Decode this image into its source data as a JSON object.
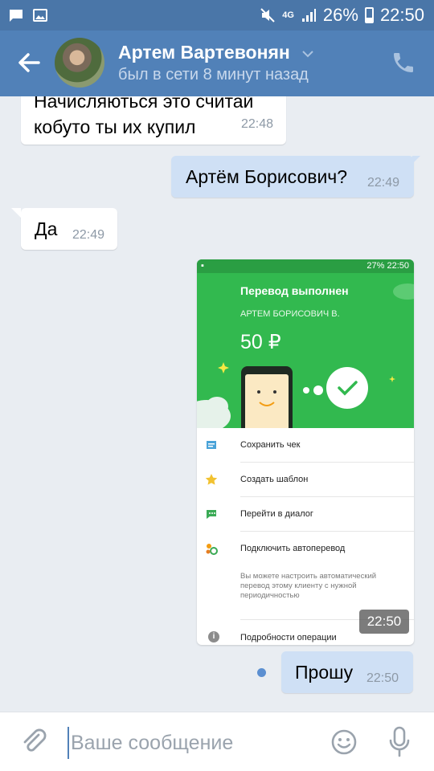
{
  "status_bar": {
    "signal": "4G",
    "battery": "26%",
    "time": "22:50"
  },
  "header": {
    "name": "Артем Вартевонян",
    "status": "был в сети 8 минут назад"
  },
  "messages": [
    {
      "direction": "in",
      "text_line1": "Начисляються это считай",
      "text_line2": "кобуто ты их купил",
      "time": "22:48"
    },
    {
      "direction": "out",
      "text": "Артём Борисович?",
      "time": "22:49"
    },
    {
      "direction": "in",
      "text": "Да",
      "time": "22:49"
    },
    {
      "direction": "out",
      "text": "Прошу",
      "time": "22:50"
    }
  ],
  "shared_image": {
    "time": "22:50",
    "status_bar": {
      "battery": "27%",
      "time": "22:50"
    },
    "title": "Перевод выполнен",
    "recipient": "АРТЕМ БОРИСОВИЧ В.",
    "amount": "50 ₽",
    "actions": [
      {
        "label": "Сохранить чек",
        "icon": "receipt-icon"
      },
      {
        "label": "Создать шаблон",
        "icon": "star-icon"
      },
      {
        "label": "Перейти в диалог",
        "icon": "chat-icon"
      },
      {
        "label": "Подключить автоперевод",
        "icon": "autotransfer-icon"
      }
    ],
    "note": "Вы можете настроить автоматический перевод этому клиенту с нужной периодичностью",
    "details_label": "Подробности операции",
    "colors": {
      "green": "#32b94f",
      "dark_green": "#2a9e43"
    }
  },
  "input": {
    "placeholder": "Ваше сообщение"
  },
  "colors": {
    "header": "#5181b8",
    "status_bar": "#4a76a8",
    "outgoing_bubble": "#cfe0f5",
    "incoming_bubble": "#ffffff",
    "background": "#e9edf2"
  }
}
